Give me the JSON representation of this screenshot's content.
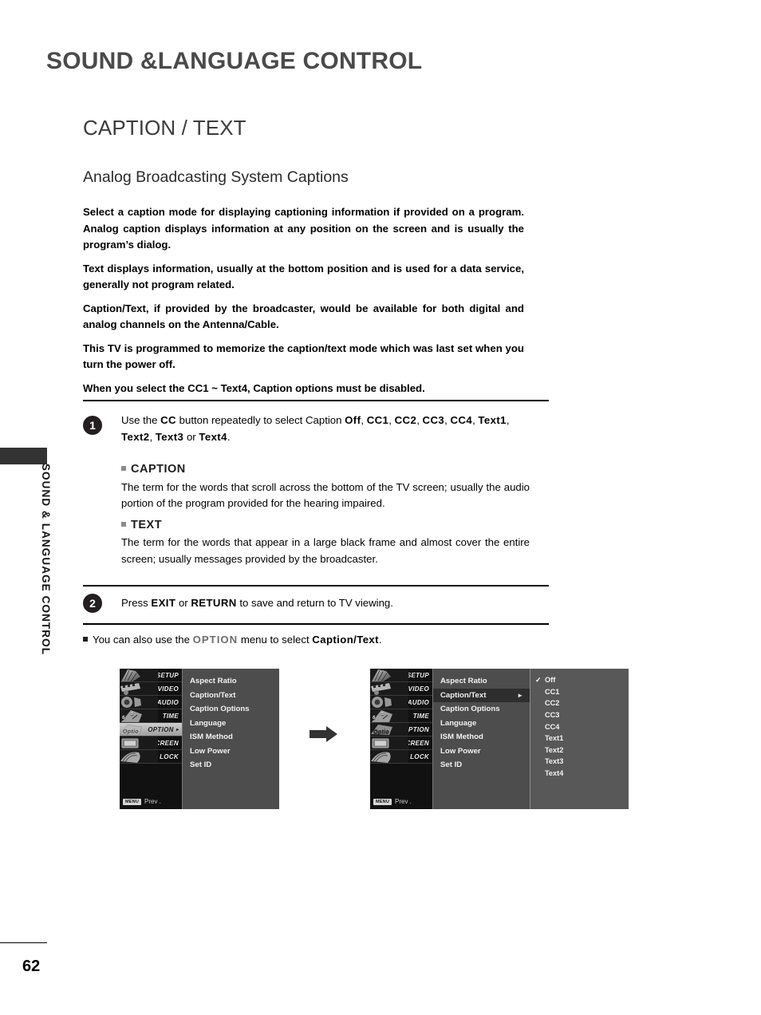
{
  "side_tab": {
    "running_head": "SOUND & LANGUAGE CONTROL"
  },
  "page": {
    "number": "62"
  },
  "headings": {
    "chapter": "SOUND &LANGUAGE CONTROL",
    "section": "CAPTION / TEXT",
    "subsection": "Analog Broadcasting System Captions"
  },
  "intro": {
    "paragraphs": [
      "Select a caption mode for displaying captioning information if provided on a program. Analog caption displays information at any position on the screen and is usually the program’s dialog.",
      "Text displays information, usually at the bottom position and is used for a data service, generally not program related.",
      "Caption/Text, if provided by the broadcaster, would be available for both digital and analog channels on the Antenna/Cable.",
      "This TV is programmed to memorize the caption/text mode which was last set when you turn the power off.",
      "When you select the CC1 ~ Text4, Caption options must be disabled."
    ]
  },
  "steps": [
    {
      "number": "1",
      "lead_1": "Use the ",
      "key_cc": "CC",
      "lead_2": " button repeatedly to select Caption ",
      "options": [
        "Off",
        "CC1",
        "CC2",
        "CC3",
        "CC4",
        "Text1",
        "Text2",
        "Text3",
        "Text4"
      ],
      "conjunction": " or ",
      "terminator": ".",
      "separator": ", ",
      "definitions": [
        {
          "label": "CAPTION",
          "text": "The term for the words that scroll across the bottom of the TV screen; usually the audio portion of the program provided for the hearing impaired."
        },
        {
          "label": "TEXT",
          "text": "The term for the words that appear in a large black frame and almost cover the entire screen; usually messages provided by the broadcaster."
        }
      ]
    },
    {
      "number": "2",
      "pre": "Press ",
      "key_exit": "EXIT",
      "mid": " or ",
      "key_return": "RETURN",
      "post": " to save and return to TV viewing."
    }
  ],
  "option_note": {
    "pre": "You can also use the ",
    "option_word": "OPTION",
    "mid": " menu to select ",
    "target": "Caption/Text",
    "post": "."
  },
  "osd": {
    "icon_items": [
      {
        "label": "SETUP",
        "icon": "fan-setup-icon",
        "active": false
      },
      {
        "label": "VIDEO",
        "icon": "filmstrip-icon",
        "active": false
      },
      {
        "label": "AUDIO",
        "icon": "speaker-icon",
        "active": false
      },
      {
        "label": "TIME",
        "icon": "clock-icon",
        "active": false
      },
      {
        "label": "OPTION",
        "icon": "option-icon",
        "active": true
      },
      {
        "label": "SCREEN",
        "icon": "screen-icon",
        "active": false
      },
      {
        "label": "LOCK",
        "icon": "lock-icon",
        "active": false
      }
    ],
    "prev_key": "MENU",
    "prev_label": "Prev .",
    "menu_items": [
      "Aspect Ratio",
      "Caption/Text",
      "Caption Options",
      "Language",
      "ISM Method",
      "Low Power",
      "Set ID"
    ],
    "selected_item": "Caption/Text",
    "submenu_arrow": "►",
    "submenu_items": [
      "Off",
      "CC1",
      "CC2",
      "CC3",
      "CC4",
      "Text1",
      "Text2",
      "Text3",
      "Text4"
    ],
    "submenu_checked": "Off",
    "check_glyph": "✓"
  },
  "colors": {
    "osd_panel": "#4d4d4d",
    "osd_submenu": "#585858",
    "osd_selected_row": "#2e2e2e",
    "side_tab": "#333333",
    "heading_gray": "#4a4a4a"
  }
}
